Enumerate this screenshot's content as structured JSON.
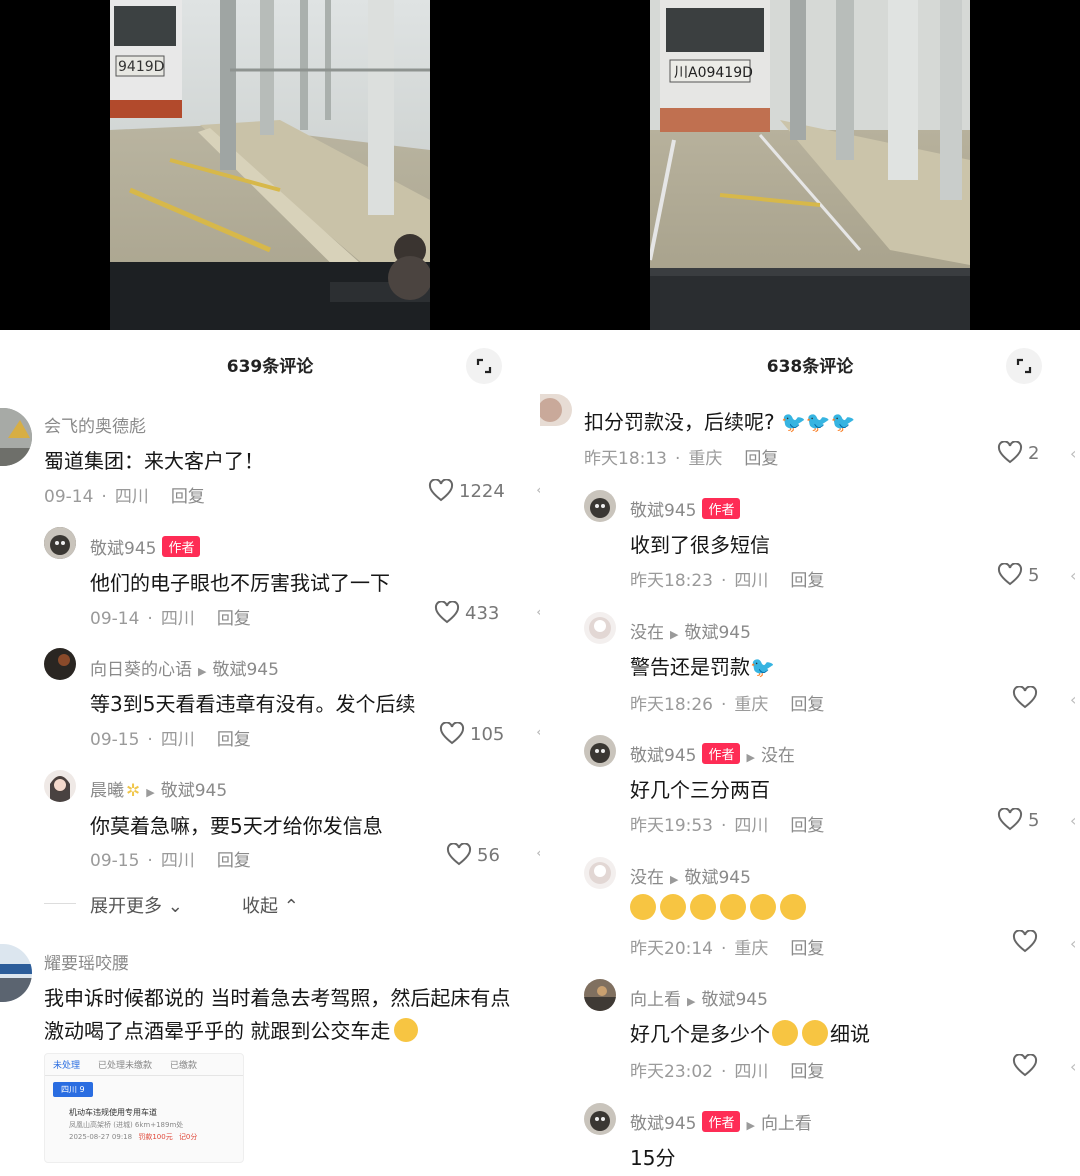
{
  "video_left": {
    "plate": "9419D"
  },
  "video_right": {
    "plate": "川A09419D"
  },
  "left_panel": {
    "title": "639条评论",
    "comments": [
      {
        "user": "会飞的奥德彪",
        "text": "蜀道集团：来大客户了！",
        "date": "09-14",
        "location": "四川",
        "reply": "回复",
        "likes": "1224"
      },
      {
        "user": "敬斌945",
        "tag": "作者",
        "text": "他们的电子眼也不厉害我试了一下",
        "date": "09-14",
        "location": "四川",
        "reply": "回复",
        "likes": "433"
      },
      {
        "user": "向日葵的心语",
        "reply_to": "敬斌945",
        "text": "等3到5天看看违章有没有。发个后续",
        "date": "09-15",
        "location": "四川",
        "reply": "回复",
        "likes": "105"
      },
      {
        "user": "晨曦",
        "reply_to": "敬斌945",
        "text": "你莫着急嘛，要5天才给你发信息",
        "date": "09-15",
        "location": "四川",
        "reply": "回复",
        "likes": "56"
      },
      {
        "user": "耀要瑶咬腰",
        "text_line1": "我申诉时候都说的  当时着急去考驾照，然后起床有点",
        "text_line2": "激动喝了点酒晕乎乎的 就跟到公交车走"
      }
    ],
    "expand_more": "展开更多",
    "collapse": "收起",
    "screenshot": {
      "tabs": [
        "未处理",
        "已处理未缴款",
        "已缴款"
      ],
      "chip": "四川 9",
      "item_title": "机动车违规使用专用车道",
      "item_location": "凤凰山高架桥 (进城) 6km+189m处",
      "item_date": "2025-08-27 09:18",
      "item_fine": "罚款100元",
      "item_points": "记0分"
    }
  },
  "right_panel": {
    "title": "638条评论",
    "comments": [
      {
        "text": "扣分罚款没，后续呢?",
        "date": "昨天18:13",
        "location": "重庆",
        "reply": "回复",
        "likes": "2"
      },
      {
        "user": "敬斌945",
        "tag": "作者",
        "text": "收到了很多短信",
        "date": "昨天18:23",
        "location": "四川",
        "reply": "回复",
        "likes": "5"
      },
      {
        "user": "没在",
        "reply_to": "敬斌945",
        "text": "警告还是罚款",
        "date": "昨天18:26",
        "location": "重庆",
        "reply": "回复",
        "likes": ""
      },
      {
        "user": "敬斌945",
        "tag": "作者",
        "reply_to": "没在",
        "text": "好几个三分两百",
        "date": "昨天19:53",
        "location": "四川",
        "reply": "回复",
        "likes": "5"
      },
      {
        "user": "没在",
        "reply_to": "敬斌945",
        "text": "",
        "date": "昨天20:14",
        "location": "重庆",
        "reply": "回复",
        "likes": ""
      },
      {
        "user": "向上看",
        "reply_to": "敬斌945",
        "text_a": "好几个是多少个",
        "text_b": "细说",
        "date": "昨天23:02",
        "location": "四川",
        "reply": "回复",
        "likes": ""
      },
      {
        "user": "敬斌945",
        "tag": "作者",
        "reply_to": "向上看",
        "text": "15分"
      }
    ]
  },
  "colors": {
    "author_tag": "#fe2c55",
    "meta": "#9a9a9a",
    "text": "#161616"
  }
}
